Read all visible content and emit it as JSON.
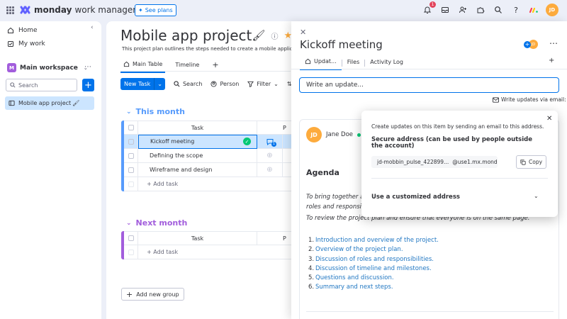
{
  "topbar": {
    "brand": "monday",
    "brand_sub": "work management",
    "see_plans": "See plans",
    "notifications_count": "1",
    "avatar_initials": "JD"
  },
  "sidebar": {
    "home": "Home",
    "my_work": "My work",
    "workspace_badge": "M",
    "workspace": "Main workspace",
    "search_placeholder": "Search",
    "board": "Mobile app project"
  },
  "board": {
    "title": "Mobile app project",
    "description": "This project plan outlines the steps needed to create a mobile applica",
    "tabs": [
      "Main Table",
      "Timeline"
    ],
    "toolbar": {
      "new_task": "New Task",
      "search": "Search",
      "person": "Person",
      "filter": "Filter"
    },
    "groups": [
      {
        "title": "This month",
        "color": "#579bfc",
        "column_header": "Task",
        "rows": [
          "Kickoff meeting",
          "Defining the scope",
          "Wireframe and design"
        ],
        "add_task": "+ Add task"
      },
      {
        "title": "Next month",
        "color": "#a25ddc",
        "column_header": "Task",
        "rows": [],
        "add_task": "+ Add task"
      }
    ],
    "conversation_count": "1",
    "add_group": "Add new group"
  },
  "panel": {
    "title": "Kickoff meeting",
    "avatar_initials": "JD",
    "tabs": [
      "Updat...",
      "Files",
      "Activity Log"
    ],
    "write_placeholder": "Write an update...",
    "via_email": "Write updates via email:",
    "post": {
      "author_initials": "JD",
      "author": "Jane Doe",
      "heading": "Agenda",
      "para1_line1": "To bring together al",
      "para1_line2": "roles and responsibi",
      "para2": "To review the project plan and ensure that everyone is on the same page.",
      "list": [
        "Introduction and overview of the project.",
        "Overview of the project plan.",
        "Discussion of roles and responsibilities.",
        "Discussion of timeline and milestones.",
        "Questions and discussion.",
        "Summary and next steps."
      ]
    }
  },
  "email_popover": {
    "intro": "Create updates on this item by sending an email to this address.",
    "secure_heading": "Secure address (can be used by people outside the account)",
    "address_user": "jd-mobbin_pulse_422899...",
    "address_domain": "@use1.mx.mond...",
    "copy": "Copy",
    "custom_heading": "Use a customized address"
  }
}
